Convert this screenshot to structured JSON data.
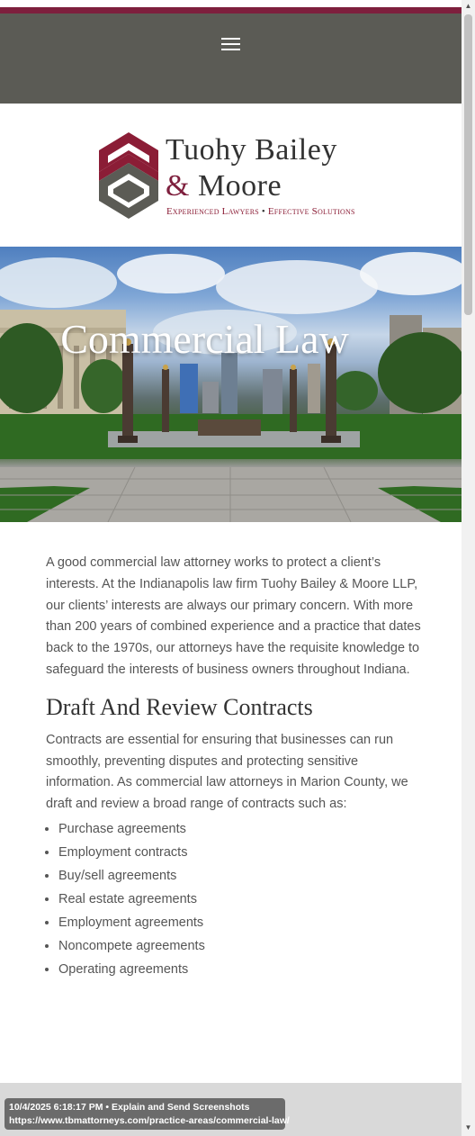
{
  "header": {
    "menu_icon": "hamburger-menu-icon",
    "accent_color": "#7e1f3d",
    "bar_color": "#5b5b55"
  },
  "logo": {
    "name_line1": "Tuohy Bailey",
    "amp": "&",
    "name_line2": "Moore",
    "tagline_part1": "Experienced Lawyers",
    "tagline_separator": "•",
    "tagline_part2": "Effective Solutions",
    "mark_colors": [
      "#8b1d36",
      "#5b5b55"
    ]
  },
  "hero": {
    "title": "Commercial Law"
  },
  "content": {
    "intro": "A good commercial law attorney works to protect a client’s interests. At the Indianapolis law firm Tuohy Bailey & Moore LLP, our clients’ interests are always our primary concern. With more than 200 years of combined experience and a practice that dates back to the 1970s, our attorneys have the requisite knowledge to safeguard the interests of business owners throughout Indiana.",
    "heading": "Draft And Review Contracts",
    "paragraph2": "Contracts are essential for ensuring that businesses can run smoothly, preventing disputes and protecting sensitive information. As commercial law attorneys in Marion County, we draft and review a broad range of contracts such as:",
    "list": [
      "Purchase agreements",
      "Employment contracts",
      "Buy/sell agreements",
      "Real estate agreements",
      "Employment agreements",
      "Noncompete agreements",
      "Operating agreements"
    ]
  },
  "stamp": {
    "line1": "10/4/2025 6:18:17 PM • Explain and Send Screenshots",
    "line2": "https://www.tbmattorneys.com/practice-areas/commercial-law/"
  },
  "scrollbar": {
    "up_icon": "scroll-up-arrow-icon",
    "down_icon": "scroll-down-arrow-icon"
  }
}
